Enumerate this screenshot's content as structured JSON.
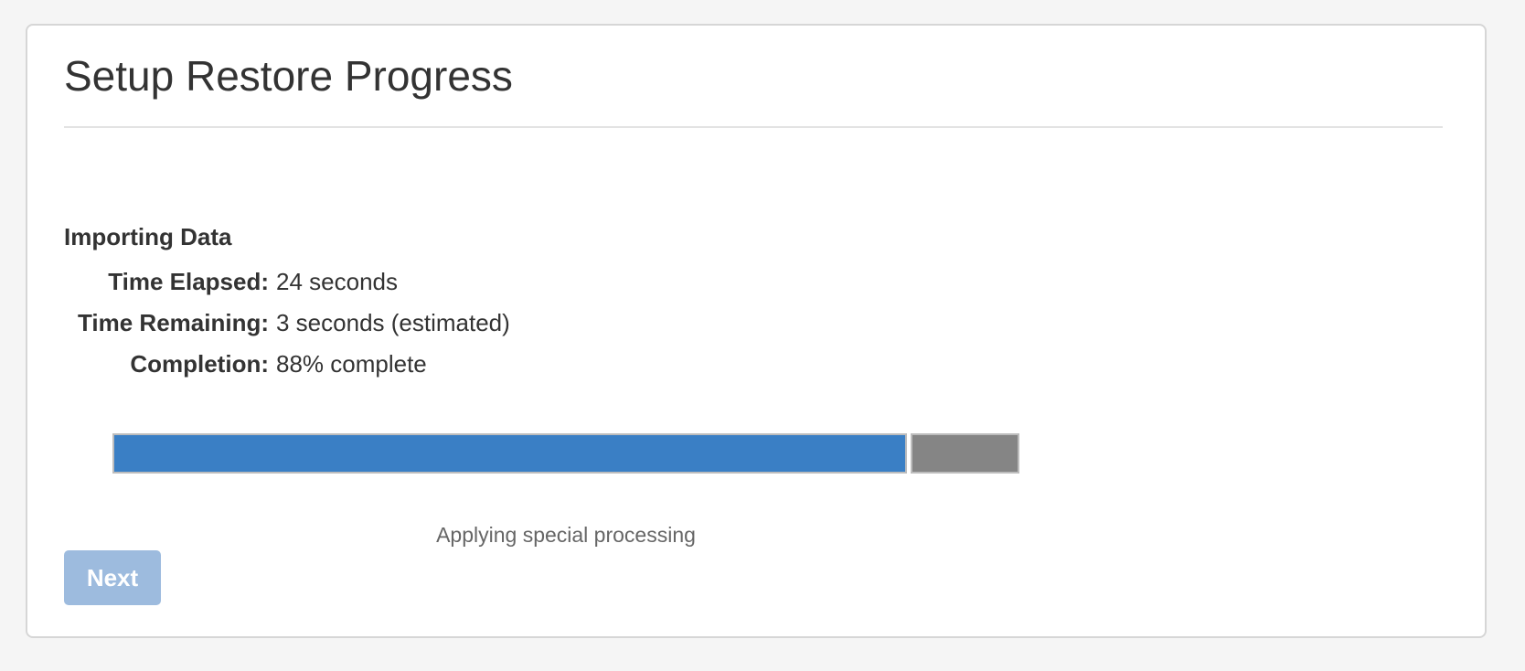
{
  "page": {
    "title": "Setup Restore Progress"
  },
  "section": {
    "heading": "Importing Data"
  },
  "stats": {
    "time_elapsed": {
      "label": "Time Elapsed:",
      "value": "24 seconds"
    },
    "time_remaining": {
      "label": "Time Remaining:",
      "value": "3 seconds (estimated)"
    },
    "completion": {
      "label": "Completion:",
      "value": "88% complete"
    }
  },
  "progress": {
    "fraction": 0.88,
    "fill_color": "#3a7fc5",
    "rest_color": "#858585",
    "status": "Applying special processing"
  },
  "actions": {
    "next_label": "Next",
    "next_enabled": false,
    "next_color": "#9dbbde"
  }
}
